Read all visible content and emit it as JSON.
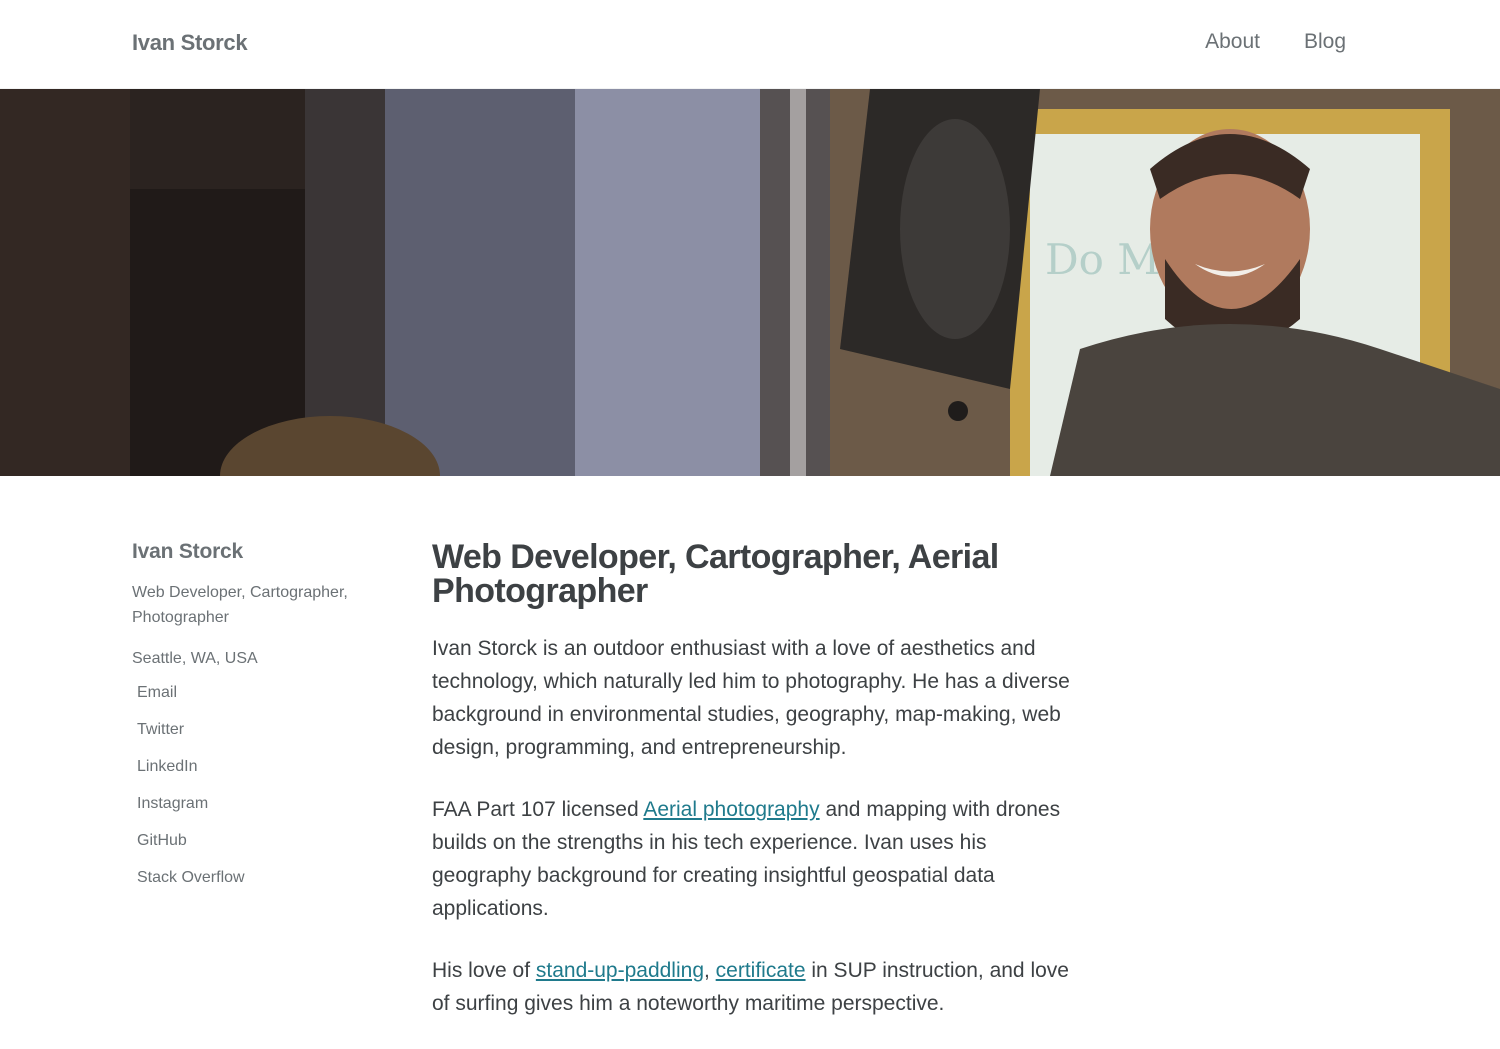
{
  "header": {
    "site_title": "Ivan Storck",
    "nav": [
      {
        "label": "About"
      },
      {
        "label": "Blog"
      }
    ]
  },
  "hero": {
    "alt_text": "",
    "colors": {
      "wall_dark": "#2b2320",
      "pillar": "#6f7180",
      "whiteboard": "#e8eee8",
      "frame": "#c9a54a",
      "shirt": "#4a443e",
      "skin": "#b07a5e"
    }
  },
  "sidebar": {
    "name": "Ivan Storck",
    "bio": "Web Developer, Cartographer, Photographer",
    "location": "Seattle, WA, USA",
    "links": [
      "Email",
      "Twitter",
      "LinkedIn",
      "Instagram",
      "GitHub",
      "Stack Overflow"
    ]
  },
  "main": {
    "title": "Web Developer, Cartographer, Aerial Photographer",
    "p1": "Ivan Storck is an outdoor enthusiast with a love of aesthetics and technology, which naturally led him to photography. He has a diverse background in environmental studies, geography, map-making, web design, programming, and entrepreneurship.",
    "p2_before": "FAA Part 107 licensed ",
    "p2_link": "Aerial photography",
    "p2_after": " and mapping with drones builds on the strengths in his tech experience. Ivan uses his geography background for creating insightful geospatial data applications.",
    "p3_before": "His love of ",
    "p3_link1": "stand-up-paddling",
    "p3_sep": ", ",
    "p3_link2": "certificate",
    "p3_after": " in SUP instruction, and love of surfing gives him a noteworthy maritime perspective."
  },
  "colors": {
    "link": "#1f7a8c",
    "muted_text": "#6b7175",
    "body_text": "#3d4144"
  }
}
